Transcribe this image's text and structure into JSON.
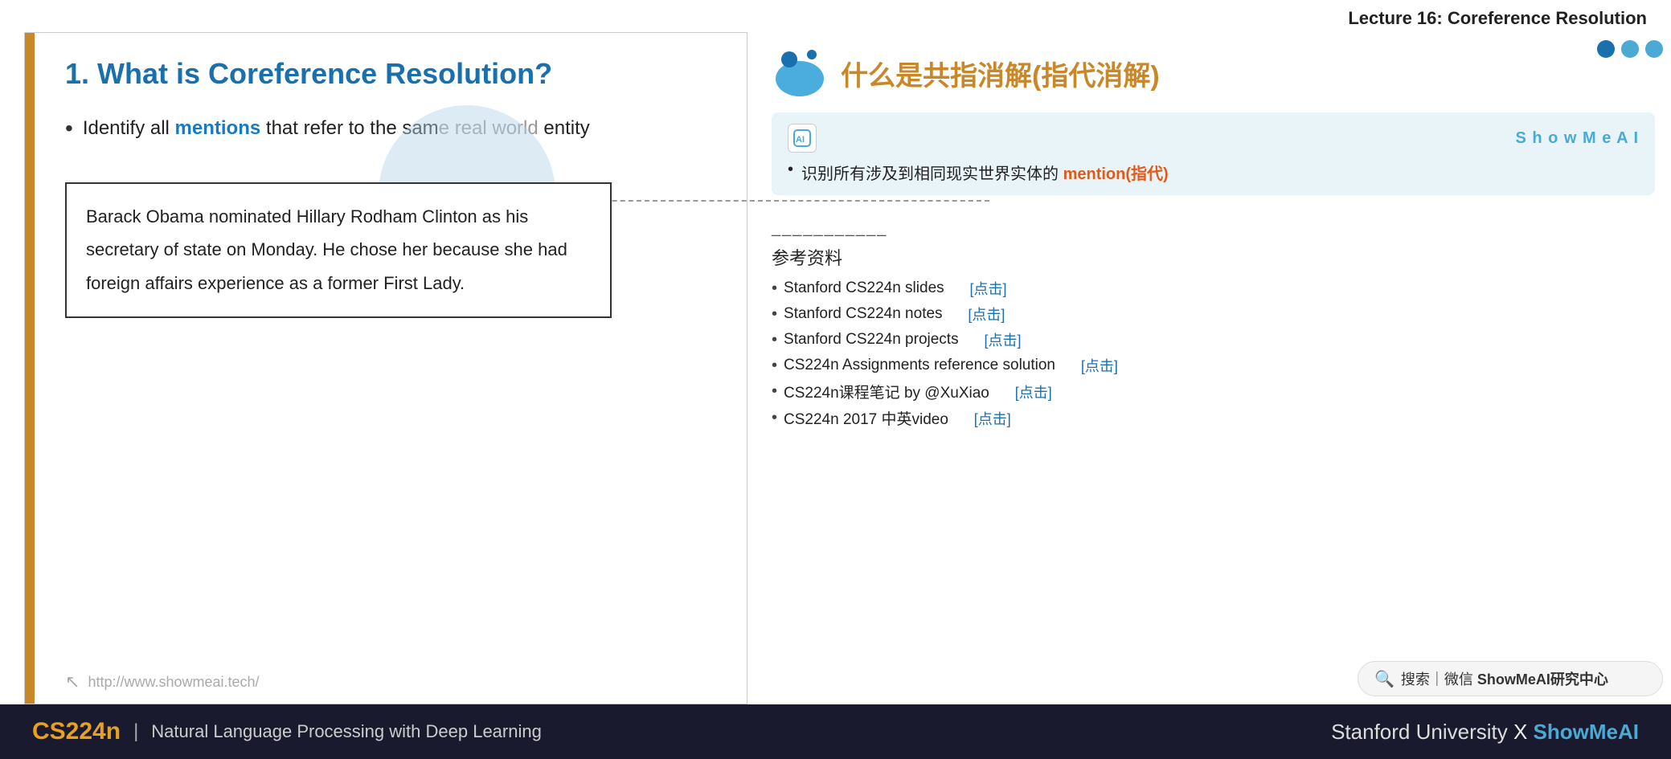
{
  "lecture_title": "Lecture 16: Coreference Resolution",
  "slide": {
    "title": "1. What is Coreference Resolution?",
    "bullet1_pre": "Identify all ",
    "bullet1_highlight": "mentions",
    "bullet1_mid": " that refer to the sam",
    "bullet1_gray": "e real world",
    "bullet1_end": " entity",
    "text_box": "Barack Obama nominated Hillary Rodham Clinton as his secretary of state on Monday. He chose her because she had foreign affairs experience as a former First Lady.",
    "footer_url": "http://www.showmeai.tech/"
  },
  "right": {
    "cn_title": "什么是共指消解(指代消解)",
    "card_pre": "识别所有涉及到相同现实世界实体的 ",
    "card_highlight": "mention(指代)",
    "watermark": "S h o w M e A I",
    "ref_divider": "___________",
    "ref_title": "参考资料",
    "references": [
      {
        "text": "Stanford CS224n slides",
        "link_label": "[点击]"
      },
      {
        "text": "Stanford CS224n notes",
        "link_label": "[点击]"
      },
      {
        "text": "Stanford CS224n projects",
        "link_label": "[点击]"
      },
      {
        "text": "CS224n Assignments reference solution",
        "link_label": "[点击]"
      },
      {
        "text": "CS224n课程笔记 by @XuXiao",
        "link_label": "[点击]"
      },
      {
        "text": "CS224n 2017 中英video",
        "link_label": "[点击]"
      }
    ],
    "search_text": "搜索｜微信 ",
    "search_brand": "ShowMeAI研究中心"
  },
  "bottom": {
    "course": "CS224n",
    "desc": "Natural Language Processing with Deep Learning",
    "right_pre": "Stanford University ",
    "x": "X",
    "brand": "ShowMeAI"
  }
}
